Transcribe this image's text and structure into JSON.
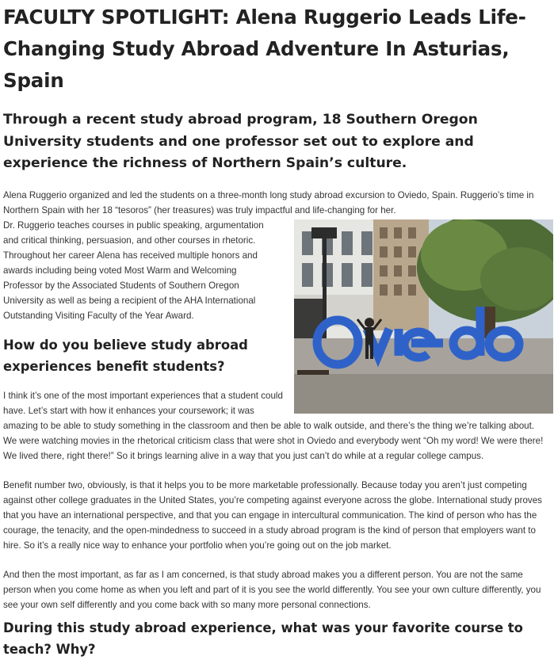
{
  "article": {
    "title": "FACULTY SPOTLIGHT: Alena Ruggerio Leads Life-Changing Study Abroad Adventure In Asturias, Spain",
    "deck": "Through a recent study abroad program, 18 Southern Oregon University students and one professor set out to explore and experience the richness of Northern Spain’s culture.",
    "intro": "Alena Ruggerio organized and led the students on a three-month long study abroad excursion to Oviedo, Spain. Ruggerio’s time in Northern Spain with her 18 “tesoros” (her treasures) was truly impactful and life-changing for her.",
    "bio": "Dr. Ruggerio teaches courses in public speaking, argumentation and critical thinking, persuasion, and other courses in rhetoric. Throughout her career Alena has received multiple honors and awards including being voted Most Warm and Welcoming Professor by the Associated Students of Southern Oregon University as well as being a recipient of the AHA International Outstanding Visiting Faculty of the Year Award.",
    "photo": {
      "sign_text": "Oviedo"
    },
    "q1": "How do you believe study abroad experiences benefit students?",
    "a1_p1": "I think it’s one of the most important experiences that a student could have. Let’s start with how it enhances your coursework; it was amazing to be able to study something in the classroom and then be able to walk outside, and there’s the thing we’re talking about. We were watching movies in the rhetorical criticism class that were shot in Oviedo and everybody went “Oh my word! We were there! We lived there, right there!” So it brings learning alive in a way that you just can’t do while at a regular college campus.",
    "a1_p2": "Benefit number two, obviously, is that it helps you to be more marketable professionally. Because today you aren’t just competing against other college graduates in the United States, you’re competing against everyone across the globe. International study proves that you have an international perspective, and that you can engage in intercultural communication. The kind of person who has the courage, the tenacity, and the open-mindedness to succeed in a study abroad program is the kind of person that employers want to hire. So it’s a really nice way to enhance your portfolio when you’re going out on the job market.",
    "a1_p3": "And then the most important, as far as I am concerned, is that study abroad makes you a different person. You are not the same person when you come home as when you left and part of it is you see the world differently. You see your own culture differently, you see your own self differently and you come back with so many more personal connections.",
    "q2": "During this study abroad experience, what was your favorite course to teach? Why?"
  },
  "colors": {
    "text": "#333333",
    "heading": "#222222",
    "sign_blue": "#2f62c9"
  }
}
